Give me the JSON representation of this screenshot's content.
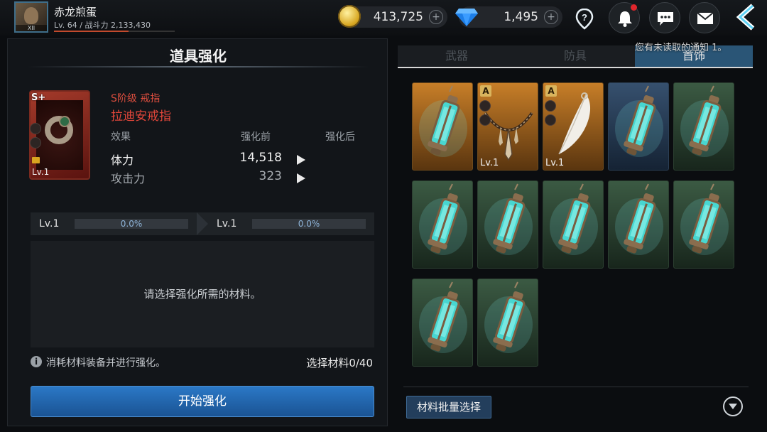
{
  "player": {
    "name": "赤龙煎蛋",
    "stats": "Lv. 64 / 战斗力 2,133,430",
    "rank": "XII"
  },
  "currency": {
    "gold": "413,725",
    "gems": "1,495"
  },
  "notification": "您有未读取的通知 1。",
  "panel": {
    "title": "道具强化",
    "item": {
      "grade_type": "S阶级 戒指",
      "name": "拉迪安戒指",
      "grade_badge": "S+",
      "level": "Lv.1"
    },
    "columns": {
      "effect": "效果",
      "before": "强化前",
      "after": "强化后"
    },
    "stats": [
      {
        "label": "体力",
        "before": "14,518"
      },
      {
        "label": "攻击力",
        "before": "323"
      }
    ],
    "progress": [
      {
        "level": "Lv.1",
        "percent_text": "0.0%",
        "fill": 0.0
      },
      {
        "level": "Lv.1",
        "percent_text": "0.0%",
        "fill": 0.0
      }
    ],
    "material_hint": "请选择强化所需的材料。",
    "info": "消耗材料装备并进行强化。",
    "select_count": "选择材料0/40",
    "start_button": "开始强化"
  },
  "tabs": [
    {
      "label": "武器",
      "active": false
    },
    {
      "label": "防具",
      "active": false
    },
    {
      "label": "首饰",
      "active": true
    }
  ],
  "inventory": [
    {
      "type": "lantern",
      "bg": "orange",
      "badge": "",
      "level": ""
    },
    {
      "type": "necklace",
      "bg": "orange",
      "badge": "A",
      "level": "Lv.1"
    },
    {
      "type": "feather",
      "bg": "orange",
      "badge": "A",
      "level": "Lv.1"
    },
    {
      "type": "lantern",
      "bg": "blue",
      "badge": "",
      "level": ""
    },
    {
      "type": "lantern",
      "bg": "green",
      "badge": "",
      "level": ""
    },
    {
      "type": "lantern",
      "bg": "green",
      "badge": "",
      "level": ""
    },
    {
      "type": "lantern",
      "bg": "green",
      "badge": "",
      "level": ""
    },
    {
      "type": "lantern",
      "bg": "green",
      "badge": "",
      "level": ""
    },
    {
      "type": "lantern",
      "bg": "green",
      "badge": "",
      "level": ""
    },
    {
      "type": "lantern",
      "bg": "green",
      "badge": "",
      "level": ""
    },
    {
      "type": "lantern",
      "bg": "green",
      "badge": "",
      "level": ""
    },
    {
      "type": "lantern",
      "bg": "green",
      "badge": "",
      "level": ""
    }
  ],
  "batch_button": "材料批量选择",
  "icons": {
    "gold": "gold-coin-icon",
    "gem": "blue-gem-icon",
    "help": "question-pin-icon",
    "bell": "bell-icon",
    "chat": "chat-bubble-icon",
    "mail": "envelope-icon",
    "back": "chevron-left-icon"
  }
}
